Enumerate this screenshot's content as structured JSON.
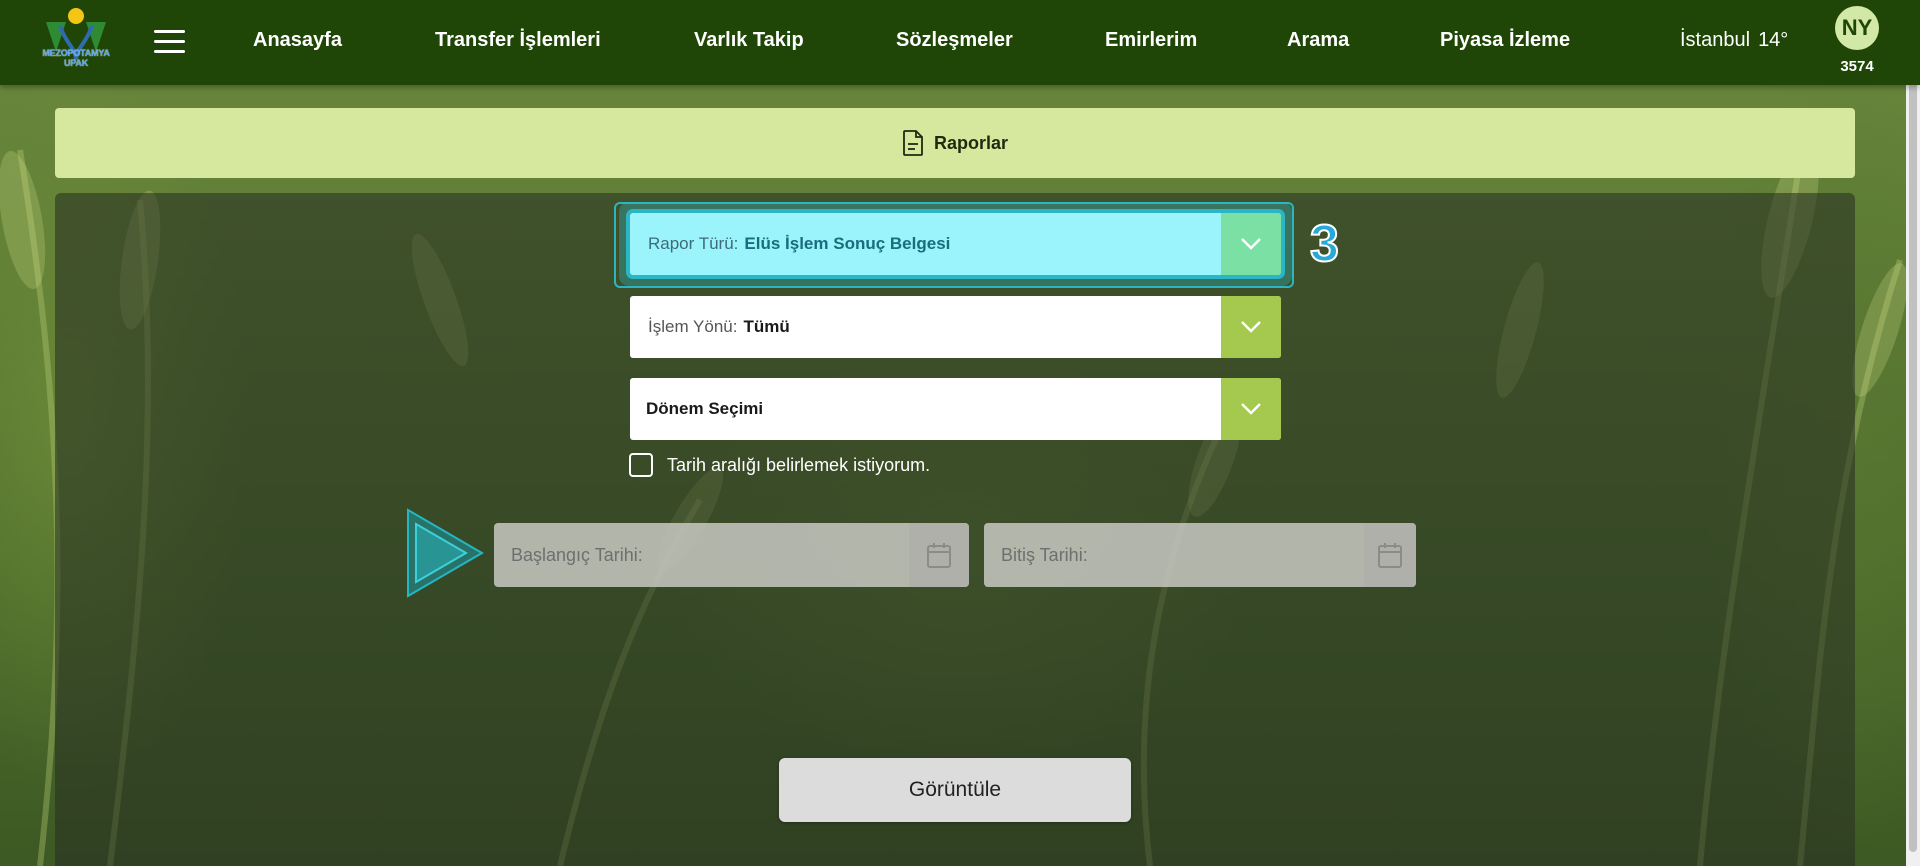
{
  "nav": {
    "logo_lines": [
      "MEZOPOTAMYA",
      "UPAK"
    ],
    "items": [
      "Anasayfa",
      "Transfer İşlemleri",
      "Varlık Takip",
      "Sözleşmeler",
      "Emirlerim",
      "Arama",
      "Piyasa İzleme"
    ],
    "weather_city": "İstanbul",
    "weather_temp": "14°",
    "avatar_initials": "NY",
    "user_code": "3574"
  },
  "banner": {
    "title": "Raporlar",
    "icon": "document-icon"
  },
  "form": {
    "report_type": {
      "label": "Rapor Türü:",
      "value": "Elüs İşlem Sonuç Belgesi"
    },
    "direction": {
      "label": "İşlem Yönü:",
      "value": "Tümü"
    },
    "period": {
      "value": "Dönem Seçimi"
    },
    "date_range_checkbox_label": "Tarih aralığı belirlemek istiyorum.",
    "start_date_placeholder": "Başlangıç Tarihi:",
    "end_date_placeholder": "Bitiş Tarihi:",
    "view_button": "Görüntüle"
  },
  "tutorial": {
    "step_number": "3"
  },
  "colors": {
    "navbar": "#1f4607",
    "banner": "#d5e89d",
    "dropdown_chevron_bg": "#a5c94e",
    "highlight": "#9bf3fb",
    "highlight_border": "#2ab6c4"
  }
}
